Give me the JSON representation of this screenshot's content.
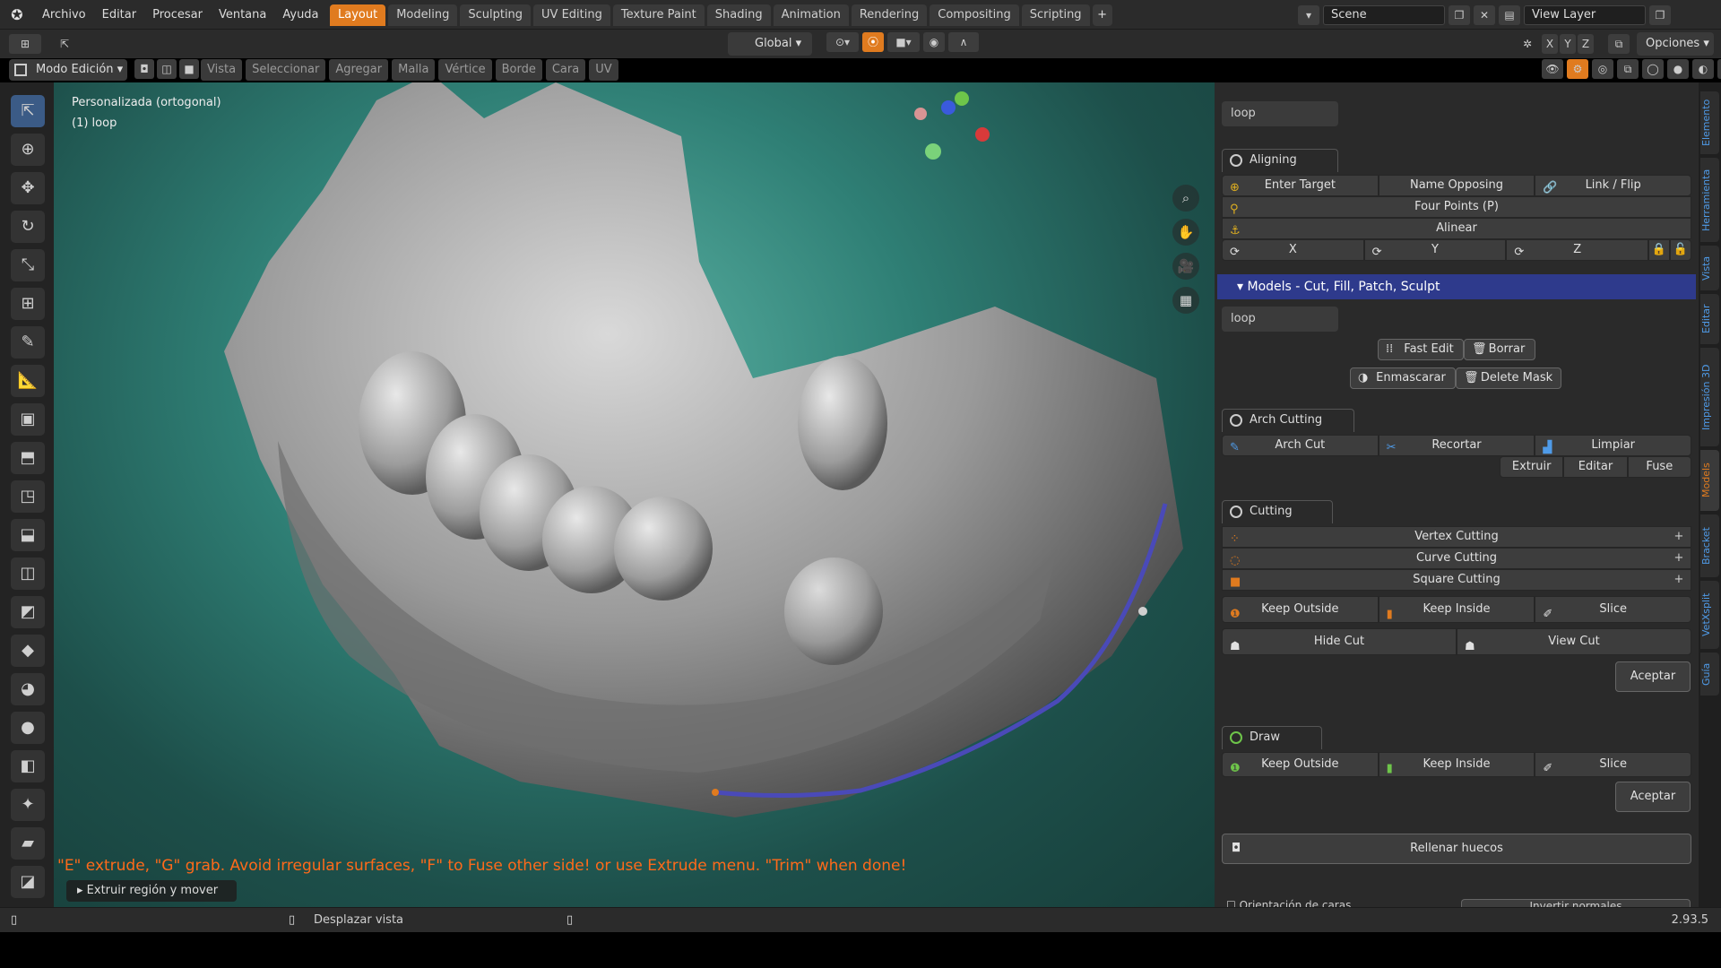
{
  "menu": [
    "Archivo",
    "Editar",
    "Procesar",
    "Ventana",
    "Ayuda"
  ],
  "workspace_tabs": [
    "Layout",
    "Modeling",
    "Sculpting",
    "UV Editing",
    "Texture Paint",
    "Shading",
    "Animation",
    "Rendering",
    "Compositing",
    "Scripting"
  ],
  "active_tab": "Layout",
  "scene": {
    "label": "Scene"
  },
  "view_layer": {
    "label": "View Layer"
  },
  "header": {
    "transform_orientation": "Global",
    "options": "Opciones",
    "mode": "Modo Edición"
  },
  "header_menu": [
    "Vista",
    "Seleccionar",
    "Agregar",
    "Malla",
    "Vértice",
    "Borde",
    "Cara",
    "UV"
  ],
  "axis_labels": {
    "x": "X",
    "y": "Y",
    "z": "Z"
  },
  "viewport": {
    "title": "Personalizada (ortogonal)",
    "object": "(1) loop",
    "hint": "\"E\" extrude, \"G\" grab. Avoid irregular surfaces, \"F\" to Fuse other side! or use Extrude menu. \"Trim\" when done!",
    "operator": "Extruir región y mover"
  },
  "sidebar": {
    "top_field": "loop",
    "aligning": {
      "title": "Aligning Scans",
      "row1": [
        "Enter Target",
        "Name Opposing",
        "Link / Flip"
      ],
      "four_points": "Four Points (P)",
      "alinear": "Alinear",
      "axes": [
        "X",
        "Y",
        "Z"
      ]
    },
    "models_header": "Models - Cut, Fill, Patch, Sculpt",
    "models_field": "loop",
    "fast_edit": "Fast Edit",
    "borrar": "Borrar",
    "enmascarar": "Enmascarar",
    "delete_mask": "Delete Mask",
    "arch": {
      "title": "Arch Cutting Tool",
      "row1": [
        "Arch Cut",
        "Recortar",
        "Limpiar"
      ],
      "row2": [
        "Extruir",
        "Editar",
        "Fuse"
      ]
    },
    "cutting": {
      "title": "Cutting Tools",
      "list": [
        "Vertex Cutting",
        "Curve Cutting",
        "Square Cutting"
      ],
      "keep": [
        "Keep Outside",
        "Keep Inside",
        "Slice"
      ],
      "view": [
        "Hide Cut",
        "View Cut"
      ],
      "aceptar": "Aceptar"
    },
    "lasso": {
      "title": "Draw Lasso",
      "keep": [
        "Keep Outside",
        "Keep Inside",
        "Slice"
      ],
      "aceptar": "Aceptar"
    },
    "rellenar": "Rellenar huecos",
    "orientacion": "Orientación de caras",
    "invertir": "Invertir normales"
  },
  "right_tabs": [
    "Elemento",
    "Herramienta",
    "Vista",
    "Editar",
    "Impresión 3D",
    "Models",
    "Bracket",
    "VetXsplit",
    "Guía"
  ],
  "status": {
    "text": "Desplazar vista",
    "version": "2.93.5"
  },
  "colors": {
    "accent": "#e07b1f",
    "panel_header": "#2e3a8c",
    "hint": "#ff6a1a"
  }
}
